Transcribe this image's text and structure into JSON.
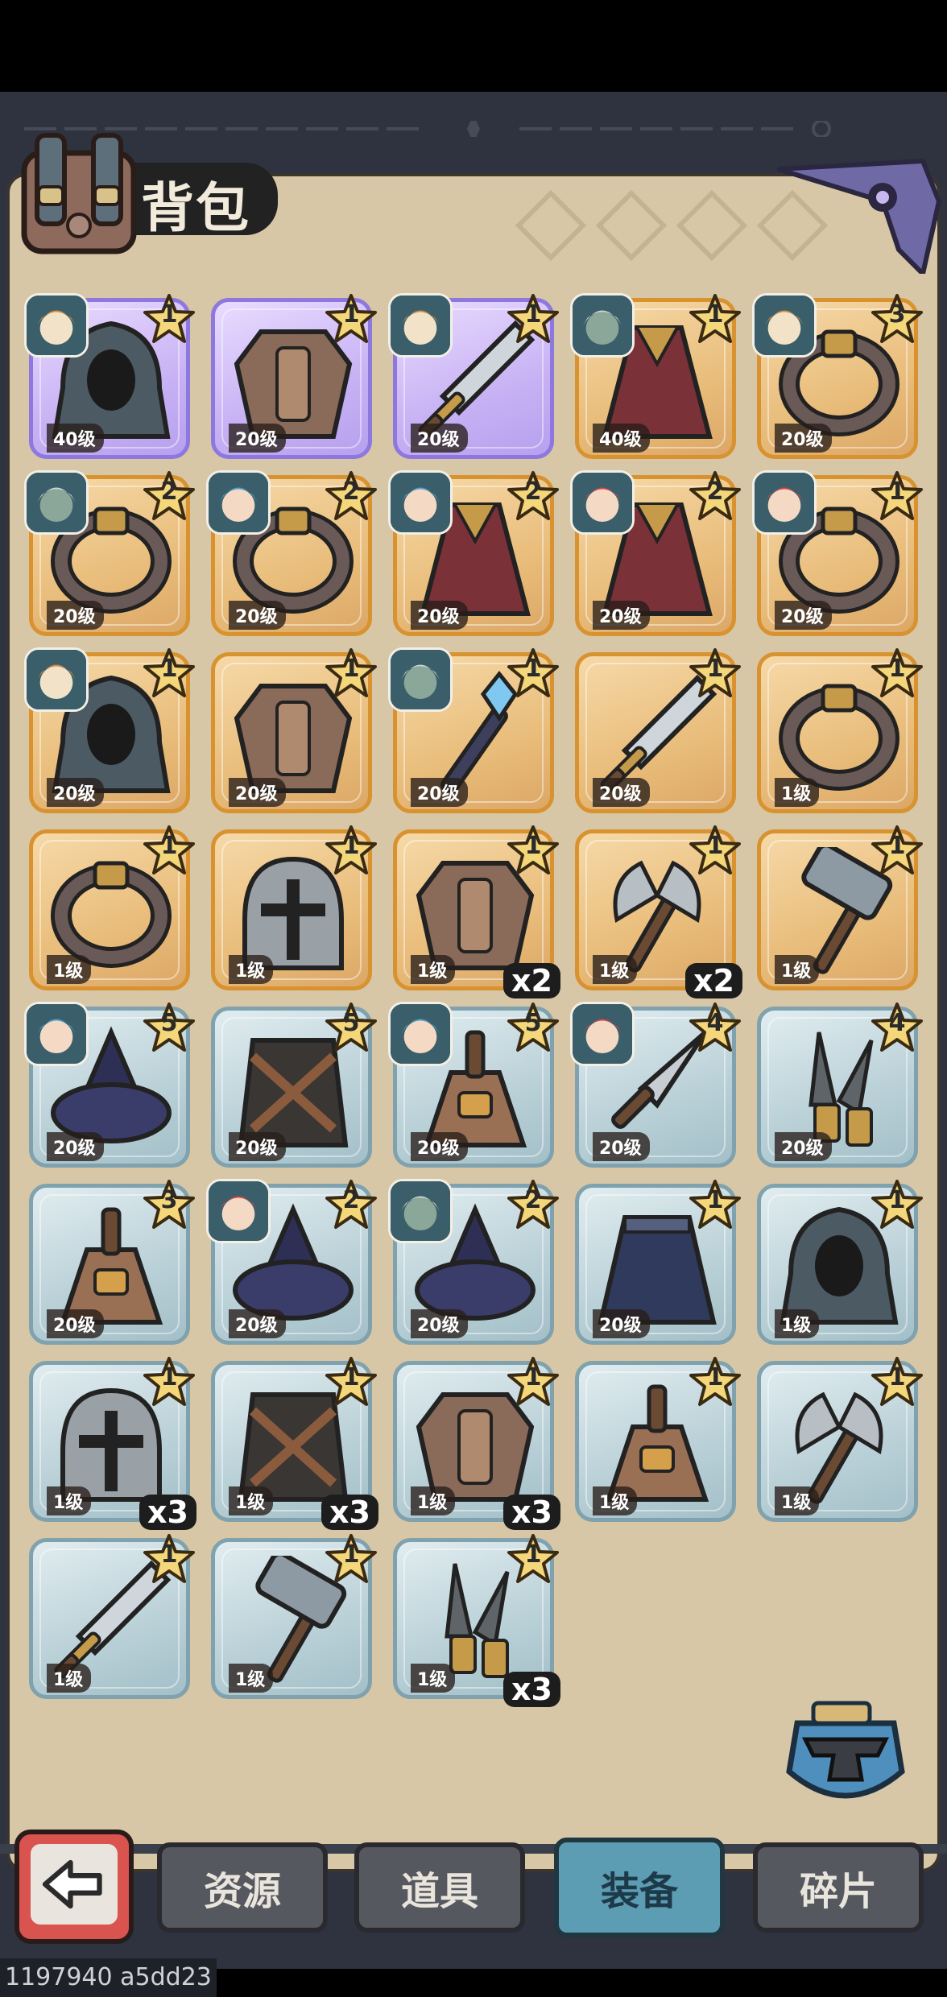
{
  "header": {
    "title": "背包"
  },
  "items": [
    {
      "rarity": "epic",
      "portrait": "tiger",
      "stars": "1",
      "level": "40级",
      "art": "hood",
      "qty": ""
    },
    {
      "rarity": "epic",
      "portrait": "",
      "stars": "1",
      "level": "20级",
      "art": "armor",
      "qty": ""
    },
    {
      "rarity": "epic",
      "portrait": "tiger",
      "stars": "1",
      "level": "20级",
      "art": "sword",
      "qty": ""
    },
    {
      "rarity": "gold",
      "portrait": "elder",
      "stars": "1",
      "level": "40级",
      "art": "cloak",
      "qty": ""
    },
    {
      "rarity": "gold",
      "portrait": "tiger",
      "stars": "3",
      "level": "20级",
      "art": "ring",
      "qty": ""
    },
    {
      "rarity": "gold",
      "portrait": "elder",
      "stars": "2",
      "level": "20级",
      "art": "ring",
      "qty": ""
    },
    {
      "rarity": "gold",
      "portrait": "elf",
      "stars": "2",
      "level": "20级",
      "art": "ring",
      "qty": ""
    },
    {
      "rarity": "gold",
      "portrait": "elf",
      "stars": "2",
      "level": "20级",
      "art": "cloak",
      "qty": ""
    },
    {
      "rarity": "gold",
      "portrait": "redhair",
      "stars": "2",
      "level": "20级",
      "art": "cloak",
      "qty": ""
    },
    {
      "rarity": "gold",
      "portrait": "redhair",
      "stars": "1",
      "level": "20级",
      "art": "ring",
      "qty": ""
    },
    {
      "rarity": "gold",
      "portrait": "tiger",
      "stars": "1",
      "level": "20级",
      "art": "hood",
      "qty": ""
    },
    {
      "rarity": "gold",
      "portrait": "",
      "stars": "1",
      "level": "20级",
      "art": "armor",
      "qty": ""
    },
    {
      "rarity": "gold",
      "portrait": "elder",
      "stars": "1",
      "level": "20级",
      "art": "staff",
      "qty": ""
    },
    {
      "rarity": "gold",
      "portrait": "",
      "stars": "1",
      "level": "20级",
      "art": "sword",
      "qty": ""
    },
    {
      "rarity": "gold",
      "portrait": "",
      "stars": "1",
      "level": "1级",
      "art": "ring",
      "qty": ""
    },
    {
      "rarity": "gold",
      "portrait": "",
      "stars": "1",
      "level": "1级",
      "art": "ring",
      "qty": ""
    },
    {
      "rarity": "gold",
      "portrait": "",
      "stars": "1",
      "level": "1级",
      "art": "helmet",
      "qty": ""
    },
    {
      "rarity": "gold",
      "portrait": "",
      "stars": "1",
      "level": "1级",
      "art": "armor",
      "qty": "x2"
    },
    {
      "rarity": "gold",
      "portrait": "",
      "stars": "1",
      "level": "1级",
      "art": "axe",
      "qty": "x2"
    },
    {
      "rarity": "gold",
      "portrait": "",
      "stars": "1",
      "level": "1级",
      "art": "hammer",
      "qty": ""
    },
    {
      "rarity": "blue",
      "portrait": "elf",
      "stars": "5",
      "level": "20级",
      "art": "hat",
      "qty": ""
    },
    {
      "rarity": "blue",
      "portrait": "",
      "stars": "5",
      "level": "20级",
      "art": "vest",
      "qty": ""
    },
    {
      "rarity": "blue",
      "portrait": "elf",
      "stars": "5",
      "level": "20级",
      "art": "bell",
      "qty": ""
    },
    {
      "rarity": "blue",
      "portrait": "redhair",
      "stars": "4",
      "level": "20级",
      "art": "dagger",
      "qty": ""
    },
    {
      "rarity": "blue",
      "portrait": "",
      "stars": "4",
      "level": "20级",
      "art": "daggers",
      "qty": ""
    },
    {
      "rarity": "blue",
      "portrait": "",
      "stars": "3",
      "level": "20级",
      "art": "bell",
      "qty": ""
    },
    {
      "rarity": "blue",
      "portrait": "redhair",
      "stars": "2",
      "level": "20级",
      "art": "hat",
      "qty": ""
    },
    {
      "rarity": "blue",
      "portrait": "elder",
      "stars": "2",
      "level": "20级",
      "art": "hat",
      "qty": ""
    },
    {
      "rarity": "blue",
      "portrait": "",
      "stars": "1",
      "level": "20级",
      "art": "skirt",
      "qty": ""
    },
    {
      "rarity": "blue",
      "portrait": "",
      "stars": "1",
      "level": "1级",
      "art": "hood",
      "qty": ""
    },
    {
      "rarity": "blue",
      "portrait": "",
      "stars": "1",
      "level": "1级",
      "art": "helmet",
      "qty": "x3"
    },
    {
      "rarity": "blue",
      "portrait": "",
      "stars": "1",
      "level": "1级",
      "art": "vest",
      "qty": "x3"
    },
    {
      "rarity": "blue",
      "portrait": "",
      "stars": "1",
      "level": "1级",
      "art": "armor",
      "qty": "x3"
    },
    {
      "rarity": "blue",
      "portrait": "",
      "stars": "1",
      "level": "1级",
      "art": "bell",
      "qty": ""
    },
    {
      "rarity": "blue",
      "portrait": "",
      "stars": "1",
      "level": "1级",
      "art": "axe",
      "qty": ""
    },
    {
      "rarity": "blue",
      "portrait": "",
      "stars": "1",
      "level": "1级",
      "art": "sword",
      "qty": ""
    },
    {
      "rarity": "blue",
      "portrait": "",
      "stars": "1",
      "level": "1级",
      "art": "hammer",
      "qty": ""
    },
    {
      "rarity": "blue",
      "portrait": "",
      "stars": "1",
      "level": "1级",
      "art": "daggers",
      "qty": "x3"
    }
  ],
  "tabs": [
    {
      "label": "资源",
      "active": false
    },
    {
      "label": "道具",
      "active": false
    },
    {
      "label": "装备",
      "active": true
    },
    {
      "label": "碎片",
      "active": false
    }
  ],
  "icons": {
    "back": "back-arrow-icon",
    "forge": "anvil-icon",
    "bag": "backpack-icon"
  },
  "colors": {
    "epic": "#b7a0ee",
    "gold": "#e9bd7b",
    "blue": "#b9d0d7",
    "active_tab": "#5d9db4",
    "back_button": "#d9534f"
  },
  "watermark": "1197940 a5dd23"
}
